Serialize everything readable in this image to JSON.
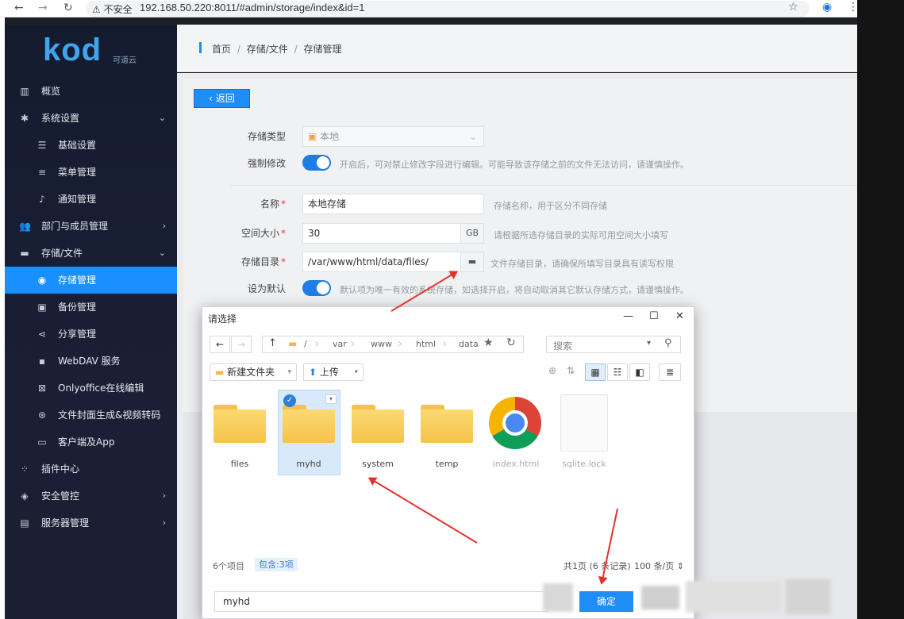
{
  "browser": {
    "insecure_label": "不安全",
    "url": "192.168.50.220:8011/#admin/storage/index&id=1",
    "back_icon": "arrow-left-icon",
    "forward_icon": "arrow-right-icon",
    "reload_icon": "reload-icon"
  },
  "logo": {
    "text": "kod",
    "sub": "可道云"
  },
  "sidebar": {
    "items": [
      {
        "label": "概览",
        "icon": "bar-chart-icon"
      },
      {
        "label": "系统设置",
        "icon": "gear-icon"
      },
      {
        "label": "基础设置",
        "icon": "sliders-icon"
      },
      {
        "label": "菜单管理",
        "icon": "menu-icon"
      },
      {
        "label": "通知管理",
        "icon": "bell-icon"
      },
      {
        "label": "部门与成员管理",
        "icon": "users-icon"
      },
      {
        "label": "存储/文件",
        "icon": "folder-icon"
      },
      {
        "label": "存储管理",
        "icon": "database-icon"
      },
      {
        "label": "备份管理",
        "icon": "save-icon"
      },
      {
        "label": "分享管理",
        "icon": "share-icon"
      },
      {
        "label": "WebDAV 服务",
        "icon": "webdav-icon"
      },
      {
        "label": "Onlyoffice在线编辑",
        "icon": "office-icon"
      },
      {
        "label": "文件封面生成&视频转码",
        "icon": "film-icon"
      },
      {
        "label": "客户端及App",
        "icon": "monitor-icon"
      },
      {
        "label": "插件中心",
        "icon": "grid-icon"
      },
      {
        "label": "安全管控",
        "icon": "shield-icon"
      },
      {
        "label": "服务器管理",
        "icon": "server-icon"
      }
    ]
  },
  "breadcrumb": {
    "home": "首页",
    "storage": "存储/文件",
    "current": "存储管理",
    "sep": "/"
  },
  "form": {
    "back_label": "返回",
    "type_label": "存储类型",
    "type_value": "本地",
    "force_label": "强制修改",
    "force_hint": "开启后，可对禁止修改字段进行编辑。可能导致该存储之前的文件无法访问，请谨慎操作。",
    "name_label": "名称",
    "name_value": "本地存储",
    "name_hint": "存储名称，用于区分不同存储",
    "size_label": "空间大小",
    "size_value": "30",
    "size_unit": "GB",
    "size_hint": "请根据所选存储目录的实际可用空间大小填写",
    "dir_label": "存储目录",
    "dir_value": "/var/www/html/data/files/",
    "dir_hint": "文件存储目录，请确保所填写目录具有读写权限",
    "default_label": "设为默认",
    "default_hint": "默认项为唯一有效的系统存储，如选择开启，将自动取消其它默认存储方式，请谨慎操作。",
    "required_mark": "*"
  },
  "dialog": {
    "title": "请选择",
    "path": [
      "/",
      "var",
      "www",
      "html",
      "data"
    ],
    "search_placeholder": "搜索",
    "new_folder": "新建文件夹",
    "upload": "上传",
    "files": [
      {
        "name": "files",
        "type": "folder"
      },
      {
        "name": "myhd",
        "type": "folder"
      },
      {
        "name": "system",
        "type": "folder"
      },
      {
        "name": "temp",
        "type": "folder"
      },
      {
        "name": "index.html",
        "type": "html"
      },
      {
        "name": "sqlite.lock",
        "type": "file"
      }
    ],
    "count": "6个项目",
    "contains": "包含:3项",
    "page_info": "共1页 (6 条记录)",
    "per_page": "100 条/页",
    "input_value": "myhd",
    "ok_label": "确定"
  }
}
